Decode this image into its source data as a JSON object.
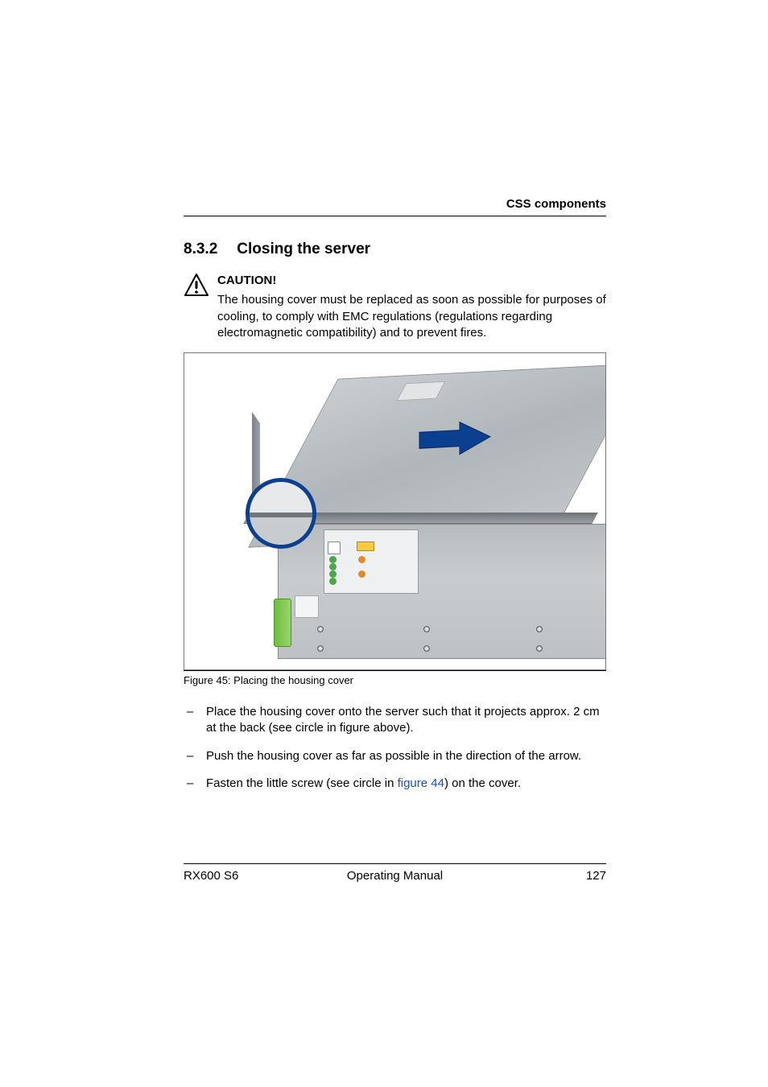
{
  "header": {
    "running": "CSS components"
  },
  "section": {
    "number": "8.3.2",
    "title": "Closing the server"
  },
  "caution": {
    "label": "CAUTION!",
    "body": "The housing cover must be replaced as soon as possible for purposes of cooling, to comply with EMC regulations (regulations regarding electromagnetic compatibility) and to prevent fires."
  },
  "figure": {
    "caption": "Figure 45: Placing the housing cover"
  },
  "steps": [
    "Place the housing cover onto the server such that it projects approx. 2 cm at the back (see circle in figure above).",
    "Push the housing cover as far as possible in the direction of the arrow."
  ],
  "step_fasten": {
    "pre": "Fasten the little screw (see circle in ",
    "link": "figure 44",
    "post": ") on the cover."
  },
  "footer": {
    "left": "RX600 S6",
    "center": "Operating Manual",
    "right": "127"
  }
}
